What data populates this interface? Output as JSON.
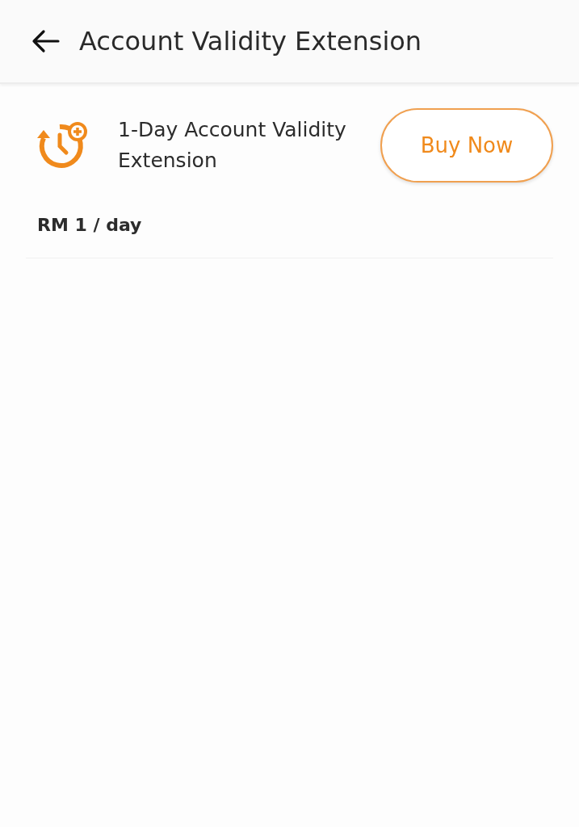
{
  "header": {
    "title": "Account Validity Extension"
  },
  "offers": [
    {
      "title": "1-Day Account Validity Extension",
      "button": "Buy Now",
      "price": "RM 1 / day"
    }
  ]
}
